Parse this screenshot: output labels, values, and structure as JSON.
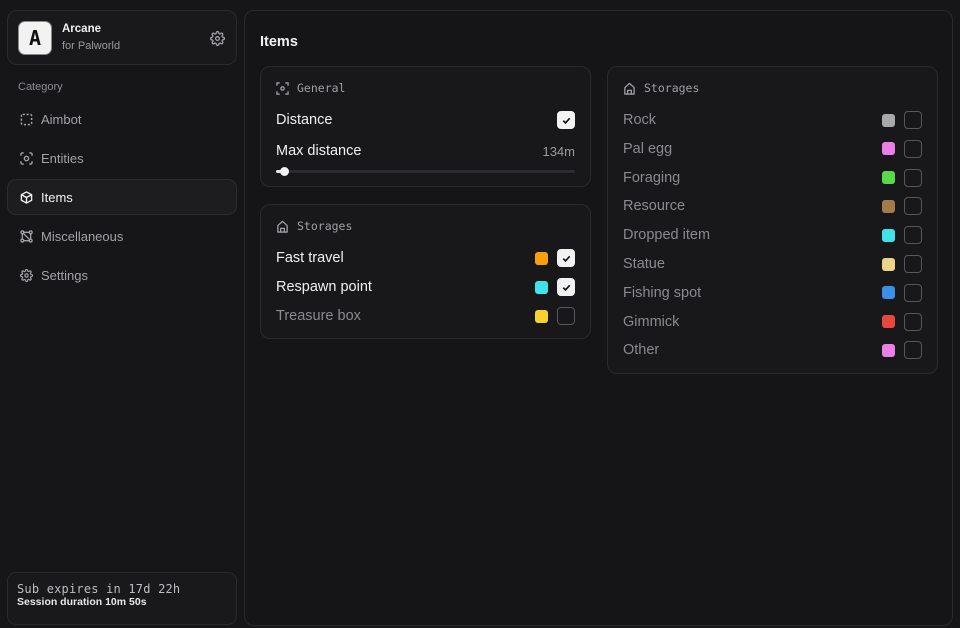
{
  "brand": {
    "logo_letter": "A",
    "name": "Arcane",
    "subtitle": "for Palworld",
    "settings_icon": "gear-icon"
  },
  "sidebar": {
    "category_label": "Category",
    "items": [
      {
        "label": "Aimbot",
        "icon": "crosshair-icon",
        "active": false
      },
      {
        "label": "Entities",
        "icon": "scan-icon",
        "active": false
      },
      {
        "label": "Items",
        "icon": "cube-icon",
        "active": true
      },
      {
        "label": "Miscellaneous",
        "icon": "nodes-icon",
        "active": false
      },
      {
        "label": "Settings",
        "icon": "gear-icon",
        "active": false
      }
    ],
    "subscription": {
      "expires": "Sub expires in 17d 22h",
      "session": "Session duration 10m 50s"
    }
  },
  "main": {
    "title": "Items",
    "general": {
      "header": "General",
      "distance_label": "Distance",
      "distance_checked": true,
      "max_distance_label": "Max distance",
      "max_distance_value": "134m",
      "max_distance_fraction": 0.02
    },
    "storages_left": {
      "header": "Storages",
      "rows": [
        {
          "label": "Fast travel",
          "color": "#f5a00c",
          "checked": true,
          "dim": false
        },
        {
          "label": "Respawn point",
          "color": "#3fe3ea",
          "checked": true,
          "dim": false
        },
        {
          "label": "Treasure box",
          "color": "#f7d12e",
          "checked": false,
          "dim": true
        }
      ]
    },
    "storages_right": {
      "header": "Storages",
      "rows": [
        {
          "label": "Rock",
          "color": "#a8a8a8",
          "checked": false
        },
        {
          "label": "Pal egg",
          "color": "#ea7fe6",
          "checked": false
        },
        {
          "label": "Foraging",
          "color": "#59d84a",
          "checked": false
        },
        {
          "label": "Resource",
          "color": "#a27a4c",
          "checked": false
        },
        {
          "label": "Dropped item",
          "color": "#3fe3ea",
          "checked": false
        },
        {
          "label": "Statue",
          "color": "#ecd38a",
          "checked": false
        },
        {
          "label": "Fishing spot",
          "color": "#3a8fe6",
          "checked": false
        },
        {
          "label": "Gimmick",
          "color": "#e8473f",
          "checked": false
        },
        {
          "label": "Other",
          "color": "#ea7fe6",
          "checked": false
        }
      ]
    }
  }
}
